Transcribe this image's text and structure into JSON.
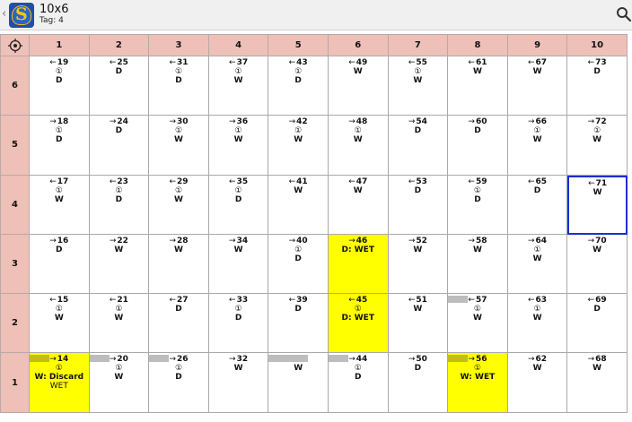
{
  "header": {
    "back_glyph": "‹",
    "title": "10x6",
    "subtitle": "Tag: 4",
    "logo_icon": "shield-logo-icon",
    "logo_symbol": "S",
    "search_icon": "search-icon"
  },
  "grid": {
    "corner_icon": "crosshair-icon",
    "columns": [
      "1",
      "2",
      "3",
      "4",
      "5",
      "6",
      "7",
      "8",
      "9",
      "10"
    ],
    "rows": [
      {
        "label": "6",
        "cells": [
          {
            "arrow": "←",
            "num": "19",
            "mark": "①",
            "code": "D"
          },
          {
            "arrow": "←",
            "num": "25",
            "mark": "",
            "code": "D"
          },
          {
            "arrow": "←",
            "num": "31",
            "mark": "①",
            "code": "D"
          },
          {
            "arrow": "←",
            "num": "37",
            "mark": "①",
            "code": "W"
          },
          {
            "arrow": "←",
            "num": "43",
            "mark": "①",
            "code": "D"
          },
          {
            "arrow": "←",
            "num": "49",
            "mark": "",
            "code": "W"
          },
          {
            "arrow": "←",
            "num": "55",
            "mark": "①",
            "code": "W"
          },
          {
            "arrow": "←",
            "num": "61",
            "mark": "",
            "code": "W"
          },
          {
            "arrow": "←",
            "num": "67",
            "mark": "",
            "code": "W"
          },
          {
            "arrow": "←",
            "num": "73",
            "mark": "",
            "code": "D"
          }
        ]
      },
      {
        "label": "5",
        "cells": [
          {
            "arrow": "→",
            "num": "18",
            "mark": "①",
            "code": "D"
          },
          {
            "arrow": "→",
            "num": "24",
            "mark": "",
            "code": "D"
          },
          {
            "arrow": "→",
            "num": "30",
            "mark": "①",
            "code": "W"
          },
          {
            "arrow": "→",
            "num": "36",
            "mark": "①",
            "code": "W"
          },
          {
            "arrow": "→",
            "num": "42",
            "mark": "①",
            "code": "W"
          },
          {
            "arrow": "→",
            "num": "48",
            "mark": "①",
            "code": "W"
          },
          {
            "arrow": "→",
            "num": "54",
            "mark": "",
            "code": "D"
          },
          {
            "arrow": "→",
            "num": "60",
            "mark": "",
            "code": "D"
          },
          {
            "arrow": "→",
            "num": "66",
            "mark": "①",
            "code": "W"
          },
          {
            "arrow": "→",
            "num": "72",
            "mark": "①",
            "code": "W"
          }
        ]
      },
      {
        "label": "4",
        "cells": [
          {
            "arrow": "←",
            "num": "17",
            "mark": "①",
            "code": "W"
          },
          {
            "arrow": "←",
            "num": "23",
            "mark": "①",
            "code": "D"
          },
          {
            "arrow": "←",
            "num": "29",
            "mark": "①",
            "code": "W"
          },
          {
            "arrow": "←",
            "num": "35",
            "mark": "①",
            "code": "D"
          },
          {
            "arrow": "←",
            "num": "41",
            "mark": "",
            "code": "W"
          },
          {
            "arrow": "←",
            "num": "47",
            "mark": "",
            "code": "W"
          },
          {
            "arrow": "←",
            "num": "53",
            "mark": "",
            "code": "D"
          },
          {
            "arrow": "←",
            "num": "59",
            "mark": "①",
            "code": "D"
          },
          {
            "arrow": "←",
            "num": "65",
            "mark": "",
            "code": "D"
          },
          {
            "arrow": "←",
            "num": "71",
            "mark": "",
            "code": "W",
            "selected": true
          }
        ]
      },
      {
        "label": "3",
        "cells": [
          {
            "arrow": "→",
            "num": "16",
            "mark": "",
            "code": "D"
          },
          {
            "arrow": "→",
            "num": "22",
            "mark": "",
            "code": "W"
          },
          {
            "arrow": "→",
            "num": "28",
            "mark": "",
            "code": "W"
          },
          {
            "arrow": "→",
            "num": "34",
            "mark": "",
            "code": "W"
          },
          {
            "arrow": "→",
            "num": "40",
            "mark": "①",
            "code": "D"
          },
          {
            "arrow": "→",
            "num": "46",
            "mark": "",
            "code": "D: WET",
            "highlight": true
          },
          {
            "arrow": "→",
            "num": "52",
            "mark": "",
            "code": "W"
          },
          {
            "arrow": "→",
            "num": "58",
            "mark": "",
            "code": "W"
          },
          {
            "arrow": "→",
            "num": "64",
            "mark": "①",
            "code": "W"
          },
          {
            "arrow": "→",
            "num": "70",
            "mark": "",
            "code": "W"
          }
        ]
      },
      {
        "label": "2",
        "cells": [
          {
            "arrow": "←",
            "num": "15",
            "mark": "①",
            "code": "W"
          },
          {
            "arrow": "←",
            "num": "21",
            "mark": "①",
            "code": "W"
          },
          {
            "arrow": "←",
            "num": "27",
            "mark": "",
            "code": "D"
          },
          {
            "arrow": "←",
            "num": "33",
            "mark": "①",
            "code": "D"
          },
          {
            "arrow": "←",
            "num": "39",
            "mark": "",
            "code": "D"
          },
          {
            "arrow": "←",
            "num": "45",
            "mark": "①",
            "code": "D: WET",
            "highlight": true
          },
          {
            "arrow": "←",
            "num": "51",
            "mark": "",
            "code": "W"
          },
          {
            "arrow": "←",
            "num": "57",
            "mark": "①",
            "code": "W",
            "bar": "grey"
          },
          {
            "arrow": "←",
            "num": "63",
            "mark": "①",
            "code": "W"
          },
          {
            "arrow": "←",
            "num": "69",
            "mark": "",
            "code": "D"
          }
        ]
      },
      {
        "label": "1",
        "cells": [
          {
            "arrow": "→",
            "num": "14",
            "mark": "①",
            "code": "W: Discard",
            "sub": "WET",
            "highlight": true,
            "bar": "olive"
          },
          {
            "arrow": "→",
            "num": "20",
            "mark": "①",
            "code": "W",
            "bar": "grey"
          },
          {
            "arrow": "→",
            "num": "26",
            "mark": "①",
            "code": "D",
            "bar": "grey"
          },
          {
            "arrow": "→",
            "num": "32",
            "mark": "",
            "code": "W"
          },
          {
            "arrow": "→",
            "num": "38",
            "mark": "",
            "code": "W",
            "bar": "grey-long"
          },
          {
            "arrow": "→",
            "num": "44",
            "mark": "①",
            "code": "D",
            "bar": "grey"
          },
          {
            "arrow": "→",
            "num": "50",
            "mark": "",
            "code": "D"
          },
          {
            "arrow": "→",
            "num": "56",
            "mark": "①",
            "code": "W: WET",
            "highlight": true,
            "bar": "olive"
          },
          {
            "arrow": "→",
            "num": "62",
            "mark": "",
            "code": "W"
          },
          {
            "arrow": "→",
            "num": "68",
            "mark": "",
            "code": "W"
          }
        ]
      }
    ]
  },
  "colors": {
    "header_bg": "#eec0b8",
    "highlight": "#ffff00",
    "selection": "#1a2fd0",
    "bar_grey": "#bdbdbd",
    "bar_olive": "#c3bd17"
  }
}
